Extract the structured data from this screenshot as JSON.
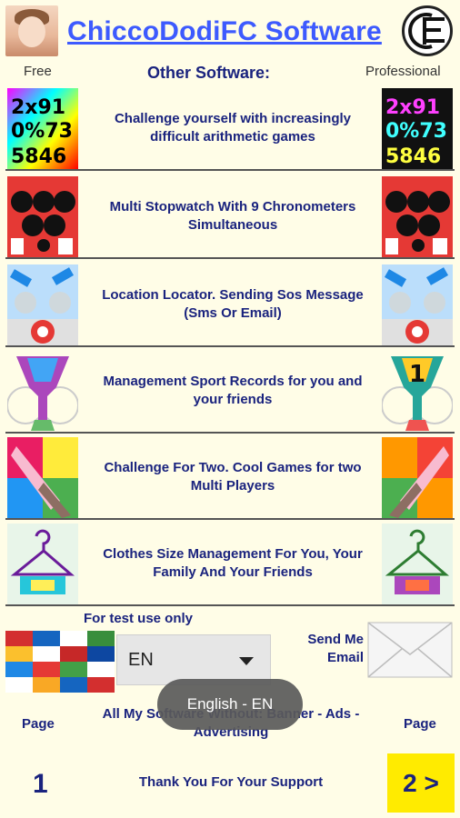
{
  "header": {
    "title": "ChiccoDodiFC Software",
    "logo_icon": "cfc-logo-icon"
  },
  "columns": {
    "free": "Free",
    "other": "Other Software:",
    "pro": "Professional"
  },
  "apps": [
    {
      "description": "Challenge yourself with increasingly difficult arithmetic games",
      "icon": "numbers-icon"
    },
    {
      "description": "Multi Stopwatch With 9 Chronometers Simultaneous",
      "icon": "stopwatch-icon"
    },
    {
      "description": "Location Locator. Sending Sos Message (Sms Or Email)",
      "icon": "satellite-icon"
    },
    {
      "description": "Management Sport Records for you and your friends",
      "icon": "trophy-icon"
    },
    {
      "description": "Challenge For Two. Cool Games for two Multi Players",
      "icon": "finger-icon"
    },
    {
      "description": "Clothes Size Management For You, Your Family And Your Friends",
      "icon": "hanger-icon"
    }
  ],
  "language": {
    "test_label": "For test use only",
    "selected": "EN",
    "toast": "English - EN"
  },
  "email": {
    "label": "Send Me Email"
  },
  "footer": {
    "page_label": "Page",
    "page_label_right": "Page",
    "all_software": "All My Software Without: Banner - Ads - Advertising",
    "page_number": "1",
    "thanks": "Thank You For Your Support",
    "next": "2 >"
  },
  "colors": {
    "background": "#fffde7",
    "title": "#3d5afe",
    "text": "#1a237e",
    "next_button": "#ffeb00"
  }
}
